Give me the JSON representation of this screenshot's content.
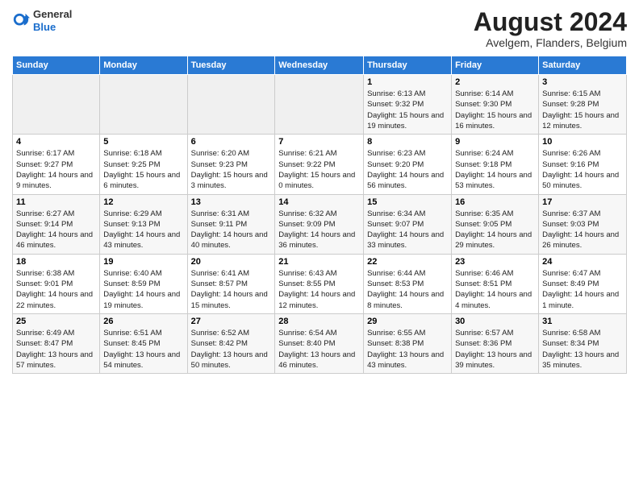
{
  "header": {
    "logo_general": "General",
    "logo_blue": "Blue",
    "month_year": "August 2024",
    "location": "Avelgem, Flanders, Belgium"
  },
  "weekdays": [
    "Sunday",
    "Monday",
    "Tuesday",
    "Wednesday",
    "Thursday",
    "Friday",
    "Saturday"
  ],
  "weeks": [
    [
      {
        "day": "",
        "empty": true
      },
      {
        "day": "",
        "empty": true
      },
      {
        "day": "",
        "empty": true
      },
      {
        "day": "",
        "empty": true
      },
      {
        "day": "1",
        "sunrise": "6:13 AM",
        "sunset": "9:32 PM",
        "daylight": "15 hours and 19 minutes."
      },
      {
        "day": "2",
        "sunrise": "6:14 AM",
        "sunset": "9:30 PM",
        "daylight": "15 hours and 16 minutes."
      },
      {
        "day": "3",
        "sunrise": "6:15 AM",
        "sunset": "9:28 PM",
        "daylight": "15 hours and 12 minutes."
      }
    ],
    [
      {
        "day": "4",
        "sunrise": "6:17 AM",
        "sunset": "9:27 PM",
        "daylight": "14 hours and 9 minutes."
      },
      {
        "day": "5",
        "sunrise": "6:18 AM",
        "sunset": "9:25 PM",
        "daylight": "15 hours and 6 minutes."
      },
      {
        "day": "6",
        "sunrise": "6:20 AM",
        "sunset": "9:23 PM",
        "daylight": "15 hours and 3 minutes."
      },
      {
        "day": "7",
        "sunrise": "6:21 AM",
        "sunset": "9:22 PM",
        "daylight": "15 hours and 0 minutes."
      },
      {
        "day": "8",
        "sunrise": "6:23 AM",
        "sunset": "9:20 PM",
        "daylight": "14 hours and 56 minutes."
      },
      {
        "day": "9",
        "sunrise": "6:24 AM",
        "sunset": "9:18 PM",
        "daylight": "14 hours and 53 minutes."
      },
      {
        "day": "10",
        "sunrise": "6:26 AM",
        "sunset": "9:16 PM",
        "daylight": "14 hours and 50 minutes."
      }
    ],
    [
      {
        "day": "11",
        "sunrise": "6:27 AM",
        "sunset": "9:14 PM",
        "daylight": "14 hours and 46 minutes."
      },
      {
        "day": "12",
        "sunrise": "6:29 AM",
        "sunset": "9:13 PM",
        "daylight": "14 hours and 43 minutes."
      },
      {
        "day": "13",
        "sunrise": "6:31 AM",
        "sunset": "9:11 PM",
        "daylight": "14 hours and 40 minutes."
      },
      {
        "day": "14",
        "sunrise": "6:32 AM",
        "sunset": "9:09 PM",
        "daylight": "14 hours and 36 minutes."
      },
      {
        "day": "15",
        "sunrise": "6:34 AM",
        "sunset": "9:07 PM",
        "daylight": "14 hours and 33 minutes."
      },
      {
        "day": "16",
        "sunrise": "6:35 AM",
        "sunset": "9:05 PM",
        "daylight": "14 hours and 29 minutes."
      },
      {
        "day": "17",
        "sunrise": "6:37 AM",
        "sunset": "9:03 PM",
        "daylight": "14 hours and 26 minutes."
      }
    ],
    [
      {
        "day": "18",
        "sunrise": "6:38 AM",
        "sunset": "9:01 PM",
        "daylight": "14 hours and 22 minutes."
      },
      {
        "day": "19",
        "sunrise": "6:40 AM",
        "sunset": "8:59 PM",
        "daylight": "14 hours and 19 minutes."
      },
      {
        "day": "20",
        "sunrise": "6:41 AM",
        "sunset": "8:57 PM",
        "daylight": "14 hours and 15 minutes."
      },
      {
        "day": "21",
        "sunrise": "6:43 AM",
        "sunset": "8:55 PM",
        "daylight": "14 hours and 12 minutes."
      },
      {
        "day": "22",
        "sunrise": "6:44 AM",
        "sunset": "8:53 PM",
        "daylight": "14 hours and 8 minutes."
      },
      {
        "day": "23",
        "sunrise": "6:46 AM",
        "sunset": "8:51 PM",
        "daylight": "14 hours and 4 minutes."
      },
      {
        "day": "24",
        "sunrise": "6:47 AM",
        "sunset": "8:49 PM",
        "daylight": "14 hours and 1 minute."
      }
    ],
    [
      {
        "day": "25",
        "sunrise": "6:49 AM",
        "sunset": "8:47 PM",
        "daylight": "13 hours and 57 minutes."
      },
      {
        "day": "26",
        "sunrise": "6:51 AM",
        "sunset": "8:45 PM",
        "daylight": "13 hours and 54 minutes."
      },
      {
        "day": "27",
        "sunrise": "6:52 AM",
        "sunset": "8:42 PM",
        "daylight": "13 hours and 50 minutes."
      },
      {
        "day": "28",
        "sunrise": "6:54 AM",
        "sunset": "8:40 PM",
        "daylight": "13 hours and 46 minutes."
      },
      {
        "day": "29",
        "sunrise": "6:55 AM",
        "sunset": "8:38 PM",
        "daylight": "13 hours and 43 minutes."
      },
      {
        "day": "30",
        "sunrise": "6:57 AM",
        "sunset": "8:36 PM",
        "daylight": "13 hours and 39 minutes."
      },
      {
        "day": "31",
        "sunrise": "6:58 AM",
        "sunset": "8:34 PM",
        "daylight": "13 hours and 35 minutes."
      }
    ]
  ],
  "labels": {
    "sunrise": "Sunrise:",
    "sunset": "Sunset:",
    "daylight": "Daylight:"
  }
}
